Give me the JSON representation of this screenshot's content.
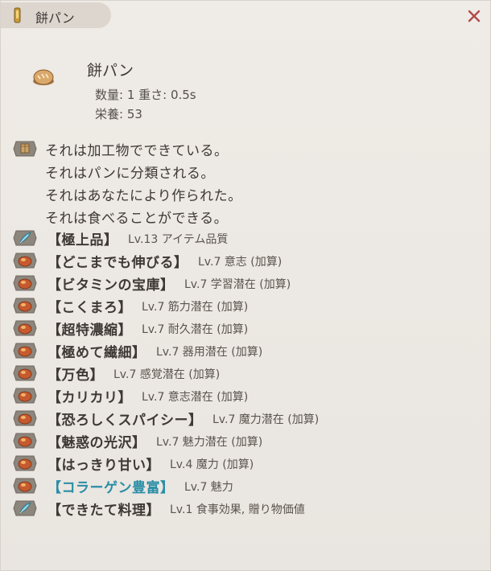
{
  "window": {
    "title": "餅パン",
    "close_symbol": "×"
  },
  "item": {
    "name": "餅パン",
    "icon": "bread-icon",
    "stats_line": "数量: 1  重さ: 0.5s",
    "nutrition_line": "栄養: 53"
  },
  "description": {
    "icon": "crate-icon",
    "lines": [
      "それは加工物でできている。",
      "それはパンに分類される。",
      "それはあなたにより作られた。",
      "それは食べることができる。"
    ]
  },
  "enchants": [
    {
      "icon": "feather-icon",
      "name": "【極上品】",
      "detail": "Lv.13 アイテム品質",
      "highlight": false
    },
    {
      "icon": "cooked-food-icon",
      "name": "【どこまでも伸びる】",
      "detail": "Lv.7 意志 (加算)",
      "highlight": false
    },
    {
      "icon": "cooked-food-icon",
      "name": "【ビタミンの宝庫】",
      "detail": "Lv.7 学習潜在 (加算)",
      "highlight": false
    },
    {
      "icon": "cooked-food-icon",
      "name": "【こくまろ】",
      "detail": "Lv.7 筋力潜在 (加算)",
      "highlight": false
    },
    {
      "icon": "cooked-food-icon",
      "name": "【超特濃縮】",
      "detail": "Lv.7 耐久潜在 (加算)",
      "highlight": false
    },
    {
      "icon": "cooked-food-icon",
      "name": "【極めて繊細】",
      "detail": "Lv.7 器用潜在 (加算)",
      "highlight": false
    },
    {
      "icon": "cooked-food-icon",
      "name": "【万色】",
      "detail": "Lv.7 感覚潜在 (加算)",
      "highlight": false
    },
    {
      "icon": "cooked-food-icon",
      "name": "【カリカリ】",
      "detail": "Lv.7 意志潜在 (加算)",
      "highlight": false
    },
    {
      "icon": "cooked-food-icon",
      "name": "【恐ろしくスパイシー】",
      "detail": "Lv.7 魔力潜在 (加算)",
      "highlight": false
    },
    {
      "icon": "cooked-food-icon",
      "name": "【魅惑の光沢】",
      "detail": "Lv.7 魅力潜在 (加算)",
      "highlight": false
    },
    {
      "icon": "cooked-food-icon",
      "name": "【はっきり甘い】",
      "detail": "Lv.4 魔力 (加算)",
      "highlight": false
    },
    {
      "icon": "cooked-food-icon",
      "name": "【コラーゲン豊富】",
      "detail": "Lv.7 魅力",
      "highlight": true
    },
    {
      "icon": "feather-icon",
      "name": "【できたて料理】",
      "detail": "Lv.1 食事効果, 贈り物価値",
      "highlight": false
    }
  ],
  "colors": {
    "background": "#ebe7e2",
    "text": "#3e3935",
    "highlight": "#2a8ea6",
    "close": "#b04a4a"
  }
}
